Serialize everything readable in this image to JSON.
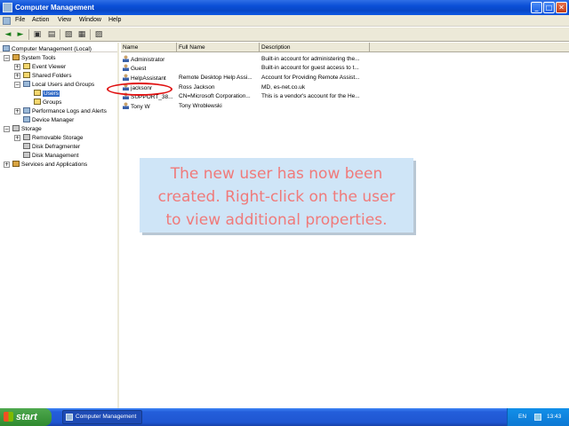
{
  "window": {
    "title": "Computer Management",
    "controls": {
      "minimize": "_",
      "maximize": "□",
      "close": "✕"
    }
  },
  "menu": [
    "File",
    "Action",
    "View",
    "Window",
    "Help"
  ],
  "toolbar": {
    "icons": [
      "back-icon",
      "forward-icon",
      "up-icon",
      "show-hide-tree-icon",
      "refresh-icon",
      "export-icon",
      "help-icon"
    ]
  },
  "tree": [
    {
      "label": "Computer Management (Local)",
      "icon": "computer-icon",
      "expander": "−"
    },
    {
      "label": "System Tools",
      "icon": "tools-icon",
      "expander": "−"
    },
    {
      "label": "Event Viewer",
      "icon": "event-viewer-icon",
      "expander": "+"
    },
    {
      "label": "Shared Folders",
      "icon": "shared-folders-icon",
      "expander": "+"
    },
    {
      "label": "Local Users and Groups",
      "icon": "users-groups-icon",
      "expander": "−"
    },
    {
      "label": "Users",
      "icon": "folder-icon",
      "selected": true
    },
    {
      "label": "Groups",
      "icon": "folder-icon"
    },
    {
      "label": "Performance Logs and Alerts",
      "icon": "performance-icon",
      "expander": "+"
    },
    {
      "label": "Device Manager",
      "icon": "device-manager-icon"
    },
    {
      "label": "Storage",
      "icon": "storage-icon",
      "expander": "−"
    },
    {
      "label": "Removable Storage",
      "icon": "removable-storage-icon",
      "expander": "+"
    },
    {
      "label": "Disk Defragmenter",
      "icon": "defrag-icon"
    },
    {
      "label": "Disk Management",
      "icon": "disk-icon"
    },
    {
      "label": "Services and Applications",
      "icon": "services-icon",
      "expander": "+"
    }
  ],
  "list": {
    "columns": [
      "Name",
      "Full Name",
      "Description"
    ],
    "rows": [
      {
        "name": "Administrator",
        "full_name": "",
        "description": "Built-in account for administering the..."
      },
      {
        "name": "Guest",
        "full_name": "",
        "description": "Built-in account for guest access to t..."
      },
      {
        "name": "HelpAssistant",
        "full_name": "Remote Desktop Help Assi...",
        "description": "Account for Providing Remote Assist..."
      },
      {
        "name": "jacksonr",
        "full_name": "Ross Jackson",
        "description": "MD, es-net.co.uk"
      },
      {
        "name": "SUPPORT_38...",
        "full_name": "CN=Microsoft Corporation...",
        "description": "This is a vendor's account for the He..."
      },
      {
        "name": "Tony W",
        "full_name": "Tony Wroblewski",
        "description": ""
      }
    ],
    "highlight_color": "#e01010"
  },
  "callout": {
    "lines": [
      "The new user has now been",
      "created. Right-click on the user",
      "to view additional properties."
    ],
    "text_color": "#f07a7a",
    "background": "#cfe5f7"
  },
  "taskbar": {
    "start_label": "start",
    "task_label": "Computer Management",
    "language": "EN",
    "clock": "13:43"
  }
}
